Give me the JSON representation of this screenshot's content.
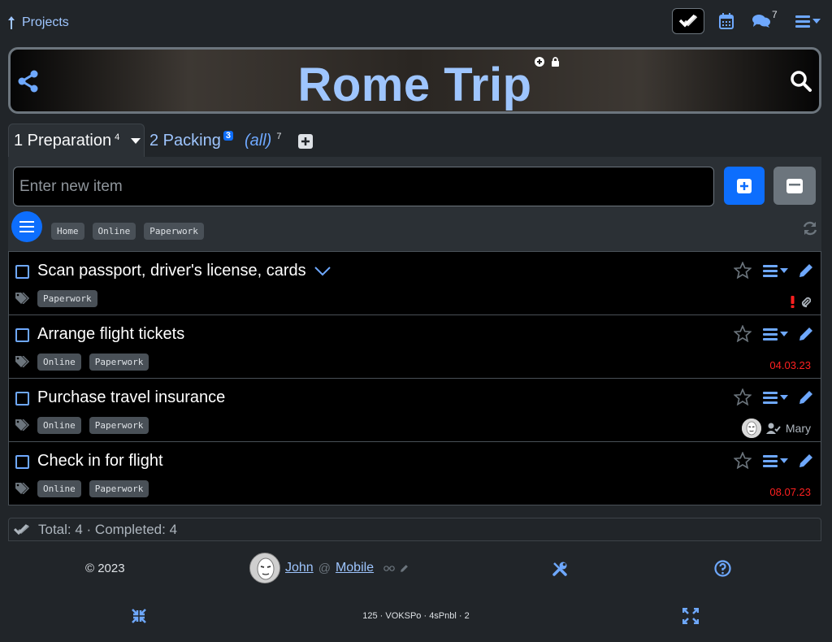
{
  "topbar": {
    "projects_label": "Projects",
    "chat_count": "7"
  },
  "project": {
    "title": "Rome Trip"
  },
  "tabs": [
    {
      "label": "1 Preparation",
      "count": "4",
      "active": true
    },
    {
      "label": "2 Packing",
      "count": "3"
    },
    {
      "label": "(all)",
      "count": "7"
    }
  ],
  "new_item": {
    "placeholder": "Enter new item",
    "value": ""
  },
  "filter_tags": [
    "Home",
    "Online",
    "Paperwork"
  ],
  "items": [
    {
      "text": "Scan passport, driver's license, cards",
      "tags": [
        "Paperwork"
      ],
      "meta": "",
      "has_expand": true
    },
    {
      "text": "Arrange flight tickets",
      "tags": [
        "Online",
        "Paperwork"
      ],
      "meta": "04.03.23"
    },
    {
      "text": "Purchase travel insurance",
      "tags": [
        "Online",
        "Paperwork"
      ],
      "assignee": "Mary"
    },
    {
      "text": "Check in for flight",
      "tags": [
        "Online",
        "Paperwork"
      ],
      "meta": "08.07.23"
    }
  ],
  "totals": "Total: 4 · Completed: 4",
  "footer": {
    "copyright": "© 2023",
    "user": "John",
    "at": "@",
    "device": "Mobile",
    "version": "125 · VOKSPo · 4sPnbl · 2"
  },
  "colors": {
    "accent": "#6ea8fe",
    "primary_button": "#0d6efd",
    "due_date": "#ff2020",
    "background": "#212529"
  }
}
